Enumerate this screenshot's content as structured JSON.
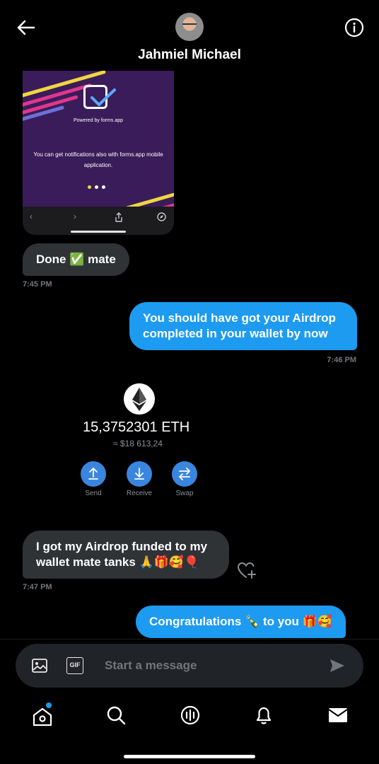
{
  "header": {
    "contact_name": "Jahmiel Michael",
    "back_icon": "arrow-left-icon",
    "info_icon": "info-circle-icon"
  },
  "screenshot_card": {
    "powered_by": "Powered by forms.app",
    "notification_text": "You can get notifications also with forms.app mobile application.",
    "page_dots": 3,
    "active_dot": 1
  },
  "messages": [
    {
      "side": "in",
      "text": "Done ✅ mate",
      "time": "7:45 PM"
    },
    {
      "side": "out",
      "text": "You should have got your Airdrop completed in your wallet by now",
      "time": "7:46 PM"
    },
    {
      "side": "in",
      "text": "I got my Airdrop funded to my wallet mate tanks 🙏🎁🥰🎈",
      "time": "7:47 PM"
    },
    {
      "side": "out",
      "text": "Congratulations 🍾 to you 🎁🥰"
    }
  ],
  "wallet_card": {
    "amount": "15,3752301 ETH",
    "fiat": "≈ $18 613,24",
    "actions": [
      {
        "label": "Send",
        "icon": "upload-arrow-icon"
      },
      {
        "label": "Receive",
        "icon": "download-arrow-icon"
      },
      {
        "label": "Swap",
        "icon": "swap-arrows-icon"
      }
    ]
  },
  "composer": {
    "placeholder": "Start a message",
    "gif_label": "GIF"
  },
  "tabbar": {
    "items": [
      "home-icon",
      "search-icon",
      "communities-icon",
      "bell-icon",
      "mail-icon"
    ],
    "home_badge_color": "#1d9bf0"
  },
  "colors": {
    "accent": "#1d9bf0",
    "incoming_bubble": "#2f3336",
    "wallet_button": "#3a86df"
  }
}
